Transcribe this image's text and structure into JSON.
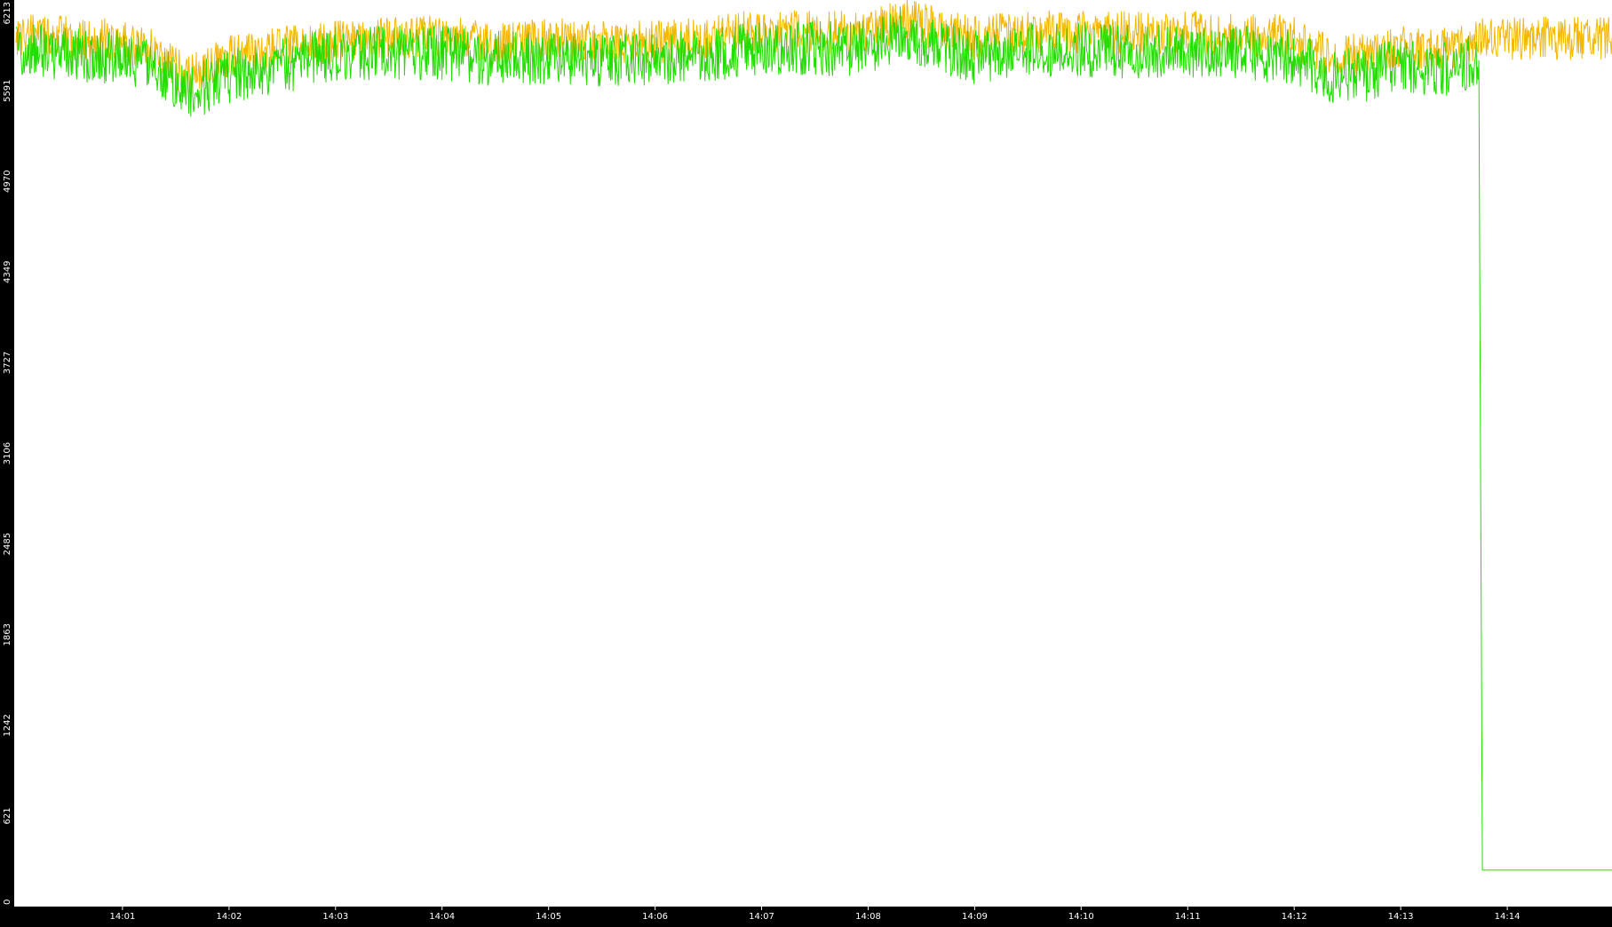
{
  "chart_data": {
    "type": "line",
    "title": "",
    "xlabel": "",
    "ylabel": "",
    "grid": false,
    "legend": "none",
    "ylim": [
      0,
      6213
    ],
    "xlim": [
      "13:59:59",
      "14:14:59"
    ],
    "y_ticks": [
      "0",
      "621",
      "1242",
      "1863",
      "2485",
      "3106",
      "3727",
      "4349",
      "4970",
      "5591",
      "6213"
    ],
    "y_tick_values": [
      0,
      621,
      1242,
      1863,
      2485,
      3106,
      3727,
      4349,
      4970,
      5591,
      6213
    ],
    "x_ticks": [
      "14:01",
      "14:02",
      "14:03",
      "14:04",
      "14:05",
      "14:06",
      "14:07",
      "14:08",
      "14:09",
      "14:10",
      "14:11",
      "14:12",
      "14:13",
      "14:14"
    ],
    "colors": {
      "background": "#000000",
      "plot_area": "#ffffff",
      "series_orange": "#f5b800",
      "series_green": "#22dd00"
    },
    "series": [
      {
        "key": "orange",
        "x": [
          "14:00:00",
          "14:00:30",
          "14:01:00",
          "14:01:20",
          "14:01:35",
          "14:01:45",
          "14:02:00",
          "14:02:30",
          "14:03:00",
          "14:03:30",
          "14:04:00",
          "14:04:30",
          "14:05:00",
          "14:05:30",
          "14:06:00",
          "14:06:30",
          "14:07:00",
          "14:07:30",
          "14:08:00",
          "14:08:20",
          "14:08:40",
          "14:09:00",
          "14:09:30",
          "14:10:00",
          "14:10:30",
          "14:11:00",
          "14:11:30",
          "14:12:00",
          "14:12:20",
          "14:12:40",
          "14:13:00",
          "14:13:20",
          "14:13:44",
          "14:13:45",
          "14:13:46",
          "14:14:59"
        ],
        "y": [
          5980,
          5950,
          5930,
          5850,
          5700,
          5730,
          5820,
          5880,
          5930,
          5960,
          5970,
          5920,
          5940,
          5930,
          5920,
          5960,
          6000,
          5990,
          5990,
          6080,
          6010,
          5950,
          6000,
          5990,
          5990,
          5990,
          5980,
          5960,
          5820,
          5840,
          5900,
          5860,
          5950,
          5950,
          5950,
          5950
        ]
      },
      {
        "key": "green",
        "x": [
          "14:00:00",
          "14:00:30",
          "14:01:00",
          "14:01:20",
          "14:01:35",
          "14:01:45",
          "14:02:00",
          "14:02:30",
          "14:03:00",
          "14:03:30",
          "14:04:00",
          "14:04:30",
          "14:05:00",
          "14:05:30",
          "14:06:00",
          "14:06:30",
          "14:07:00",
          "14:07:30",
          "14:08:00",
          "14:08:20",
          "14:08:40",
          "14:09:00",
          "14:09:30",
          "14:10:00",
          "14:10:30",
          "14:11:00",
          "14:11:30",
          "14:12:00",
          "14:12:20",
          "14:12:40",
          "14:13:00",
          "14:13:20",
          "14:13:44",
          "14:13:45",
          "14:13:46",
          "14:14:59"
        ],
        "y": [
          5880,
          5840,
          5820,
          5750,
          5580,
          5610,
          5690,
          5760,
          5840,
          5860,
          5850,
          5810,
          5820,
          5800,
          5800,
          5840,
          5880,
          5880,
          5880,
          5990,
          5900,
          5820,
          5880,
          5870,
          5860,
          5850,
          5850,
          5820,
          5690,
          5700,
          5780,
          5720,
          5800,
          2890,
          250,
          250
        ]
      }
    ]
  }
}
